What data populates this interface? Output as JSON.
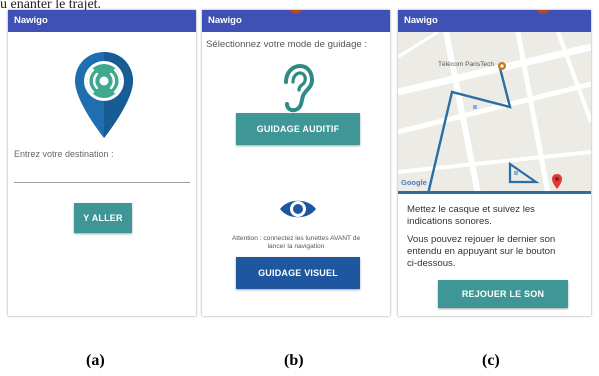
{
  "figure": {
    "top_text": "u enanter le trajet.",
    "captions": [
      "(a)",
      "(b)",
      "(c)"
    ]
  },
  "screen_a": {
    "app_title": "Nawigo",
    "destination_label": "Entrez votre destination :",
    "go_button": "Y ALLER",
    "icon": "location-pin-broadcast-icon"
  },
  "screen_b": {
    "app_title": "Nawigo",
    "prompt": "Sélectionnez votre mode de guidage :",
    "audio_button": "GUIDAGE AUDITIF",
    "warning_line1": "Attention : connectez les lunettes AVANT de",
    "warning_line2": "lancer la navigation",
    "visual_button": "GUIDAGE  VISUEL",
    "icons": [
      "ear-icon",
      "eye-icon"
    ]
  },
  "screen_c": {
    "app_title": "Nawigo",
    "map_place_label": "Télécom ParisTech",
    "map_attribution": "Google",
    "instruction_1_line1": "Mettez le casque et suivez les",
    "instruction_1_line2": "indications sonores.",
    "instruction_2_line1": "Vous pouvez rejouer le dernier son",
    "instruction_2_line2": "entendu en appuyant sur le bouton",
    "instruction_2_line3": "ci-dessous.",
    "replay_button": "REJOUER LE SON"
  },
  "colors": {
    "appbar": "#3f51b5",
    "teal_button": "#3e9696",
    "blue_button": "#1f56a0",
    "pin_blue": "#1f6fb0",
    "map_marker": "#e53935",
    "route": "#2a6ea6"
  }
}
